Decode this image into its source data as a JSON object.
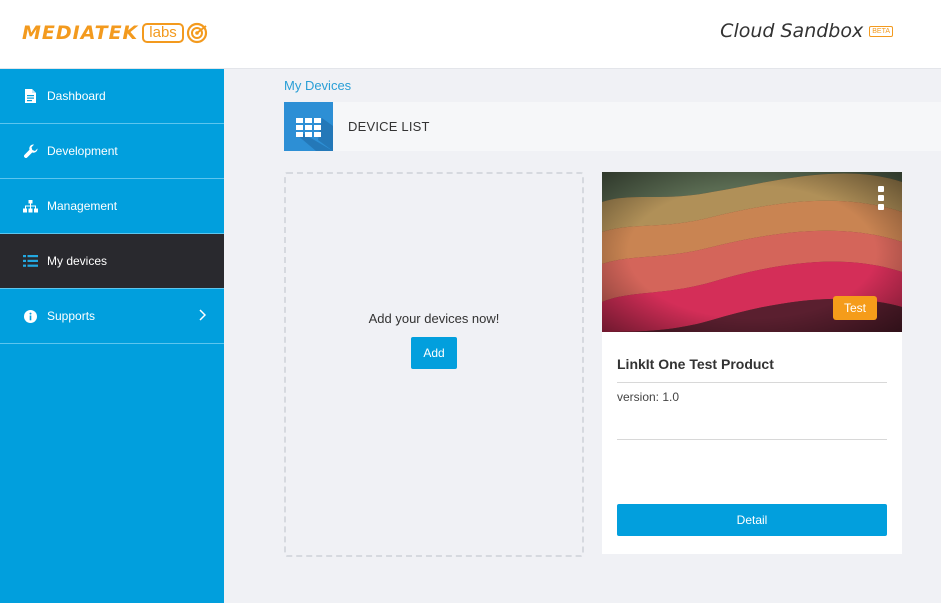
{
  "header": {
    "brand": "MEDIATEK",
    "brand_labs": "labs",
    "product": "Cloud Sandbox",
    "product_badge": "BETA"
  },
  "sidebar": {
    "items": [
      {
        "label": "Dashboard",
        "icon": "document-icon",
        "active": false
      },
      {
        "label": "Development",
        "icon": "wrench-icon",
        "active": false
      },
      {
        "label": "Management",
        "icon": "sitemap-icon",
        "active": false
      },
      {
        "label": "My devices",
        "icon": "list-icon",
        "active": true
      },
      {
        "label": "Supports",
        "icon": "info-icon",
        "active": false,
        "has_submenu": true
      }
    ]
  },
  "main": {
    "breadcrumb": "My Devices",
    "section_title": "DEVICE LIST",
    "add_card": {
      "prompt": "Add your devices now!",
      "button": "Add"
    },
    "devices": [
      {
        "name": "LinkIt One Test Product",
        "version": "version: 1.0",
        "badge": "Test",
        "detail_button": "Detail"
      }
    ]
  },
  "colors": {
    "sidebar": "#019fdd",
    "sidebar_active": "#29292e",
    "accent": "#f39a1e",
    "button": "#029fdd"
  }
}
